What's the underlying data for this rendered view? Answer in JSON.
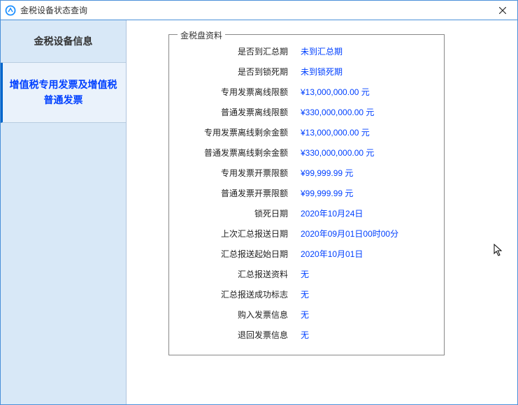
{
  "window": {
    "title": "金税设备状态查询"
  },
  "sidebar": {
    "item1": "金税设备信息",
    "item2": "增值税专用发票及增值税普通发票"
  },
  "panel": {
    "legend": "金税盘资料",
    "rows": [
      {
        "label": "是否到汇总期",
        "value": "未到汇总期"
      },
      {
        "label": "是否到锁死期",
        "value": "未到锁死期"
      },
      {
        "label": "专用发票离线限额",
        "value": "¥13,000,000.00 元"
      },
      {
        "label": "普通发票离线限额",
        "value": "¥330,000,000.00 元"
      },
      {
        "label": "专用发票离线剩余金额",
        "value": "¥13,000,000.00 元"
      },
      {
        "label": "普通发票离线剩余金额",
        "value": "¥330,000,000.00 元"
      },
      {
        "label": "专用发票开票限额",
        "value": "¥99,999.99 元"
      },
      {
        "label": "普通发票开票限额",
        "value": "¥99,999.99 元"
      },
      {
        "label": "锁死日期",
        "value": "2020年10月24日"
      },
      {
        "label": "上次汇总报送日期",
        "value": "2020年09月01日00时00分"
      },
      {
        "label": "汇总报送起始日期",
        "value": "2020年10月01日"
      },
      {
        "label": "汇总报送资料",
        "value": "无"
      },
      {
        "label": "汇总报送成功标志",
        "value": "无"
      },
      {
        "label": "购入发票信息",
        "value": "无"
      },
      {
        "label": "退回发票信息",
        "value": "无"
      }
    ]
  }
}
